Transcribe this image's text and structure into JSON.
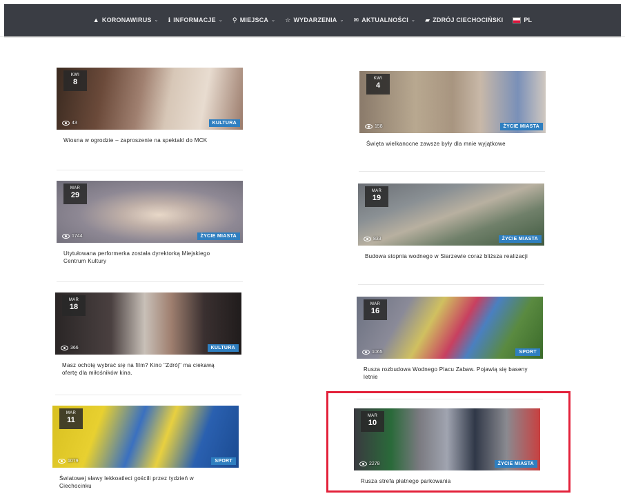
{
  "nav": {
    "items": [
      {
        "icon": "▲",
        "label": "KORONAWIRUS",
        "caret": "⌄"
      },
      {
        "icon": "ℹ",
        "label": "INFORMACJE",
        "caret": "⌄"
      },
      {
        "icon": "⚲",
        "label": "MIEJSCA",
        "caret": "⌄"
      },
      {
        "icon": "☆",
        "label": "WYDARZENIA",
        "caret": "⌄"
      },
      {
        "icon": "✉",
        "label": "AKTUALNOŚCI",
        "caret": "⌄"
      },
      {
        "icon": "▰",
        "label": "ZDRÓJ CIECHOCIŃSKI",
        "caret": ""
      }
    ],
    "language": "PL"
  },
  "articles": [
    {
      "month": "KWI",
      "day": "8",
      "views": "43",
      "category": "KULTURA",
      "title": "Wiosna w ogrodzie – zaproszenie na spektakl do MCK"
    },
    {
      "month": "KWI",
      "day": "4",
      "views": "158",
      "category": "ŻYCIE MIASTA",
      "title": "Święta wielkanocne zawsze były dla mnie wyjątkowe"
    },
    {
      "month": "MAR",
      "day": "29",
      "views": "1744",
      "category": "ŻYCIE MIASTA",
      "title": "Utytułowana performerka została dyrektorką Miejskiego Centrum Kultury"
    },
    {
      "month": "MAR",
      "day": "19",
      "views": "833",
      "category": "ŻYCIE MIASTA",
      "title": "Budowa stopnia wodnego w Siarzewie coraz bliższa realizacji"
    },
    {
      "month": "MAR",
      "day": "18",
      "views": "366",
      "category": "KULTURA",
      "title": "Masz ochotę wybrać się na film? Kino \"Zdrój\" ma ciekawą ofertę dla miłośników kina."
    },
    {
      "month": "MAR",
      "day": "16",
      "views": "1065",
      "category": "SPORT",
      "title": "Rusza rozbudowa Wodnego Placu Zabaw. Pojawią się baseny letnie"
    },
    {
      "month": "MAR",
      "day": "11",
      "views": "1079",
      "category": "SPORT",
      "title": "Światowej sławy lekkoatleci gościli przez tydzień w Ciechocinku"
    },
    {
      "month": "MAR",
      "day": "10",
      "views": "2278",
      "category": "ŻYCIE MIASTA",
      "title": "Rusza strefa płatnego parkowania"
    }
  ],
  "colors": {
    "nav_bg": "#3a3d44",
    "category_badge": "#2f7fc0",
    "highlight_border": "#e3213a"
  }
}
